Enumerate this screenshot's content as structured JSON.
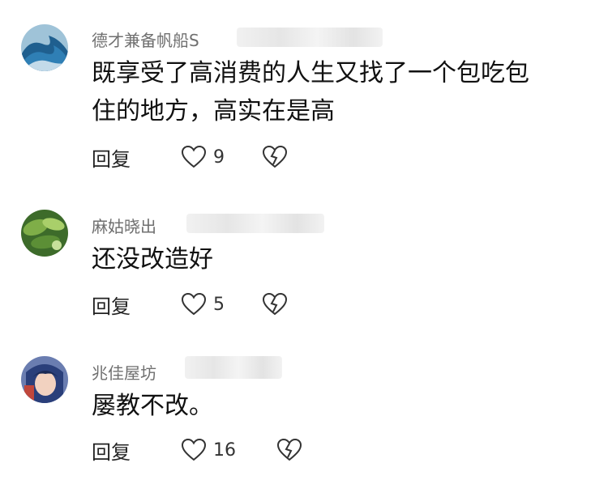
{
  "comments": [
    {
      "username": "德才兼备帆船S",
      "text": "既享受了高消费的人生又找了一个包吃包住的地方，高实在是高",
      "text_lines": [
        "既享受了高消费的人生又找了一个包吃包",
        "住的地方，高实在是高"
      ],
      "reply_label": "回复",
      "likes": "9",
      "avatar_icon": "wave-avatar-icon"
    },
    {
      "username": "麻姑晓出",
      "text": "还没改造好",
      "reply_label": "回复",
      "likes": "5",
      "avatar_icon": "plant-avatar-icon"
    },
    {
      "username": "兆佳屋坊",
      "text": "屡教不改。",
      "reply_label": "回复",
      "likes": "16",
      "avatar_icon": "anime-avatar-icon"
    }
  ],
  "icons": {
    "like": "heart-icon",
    "dislike": "broken-heart-icon"
  }
}
